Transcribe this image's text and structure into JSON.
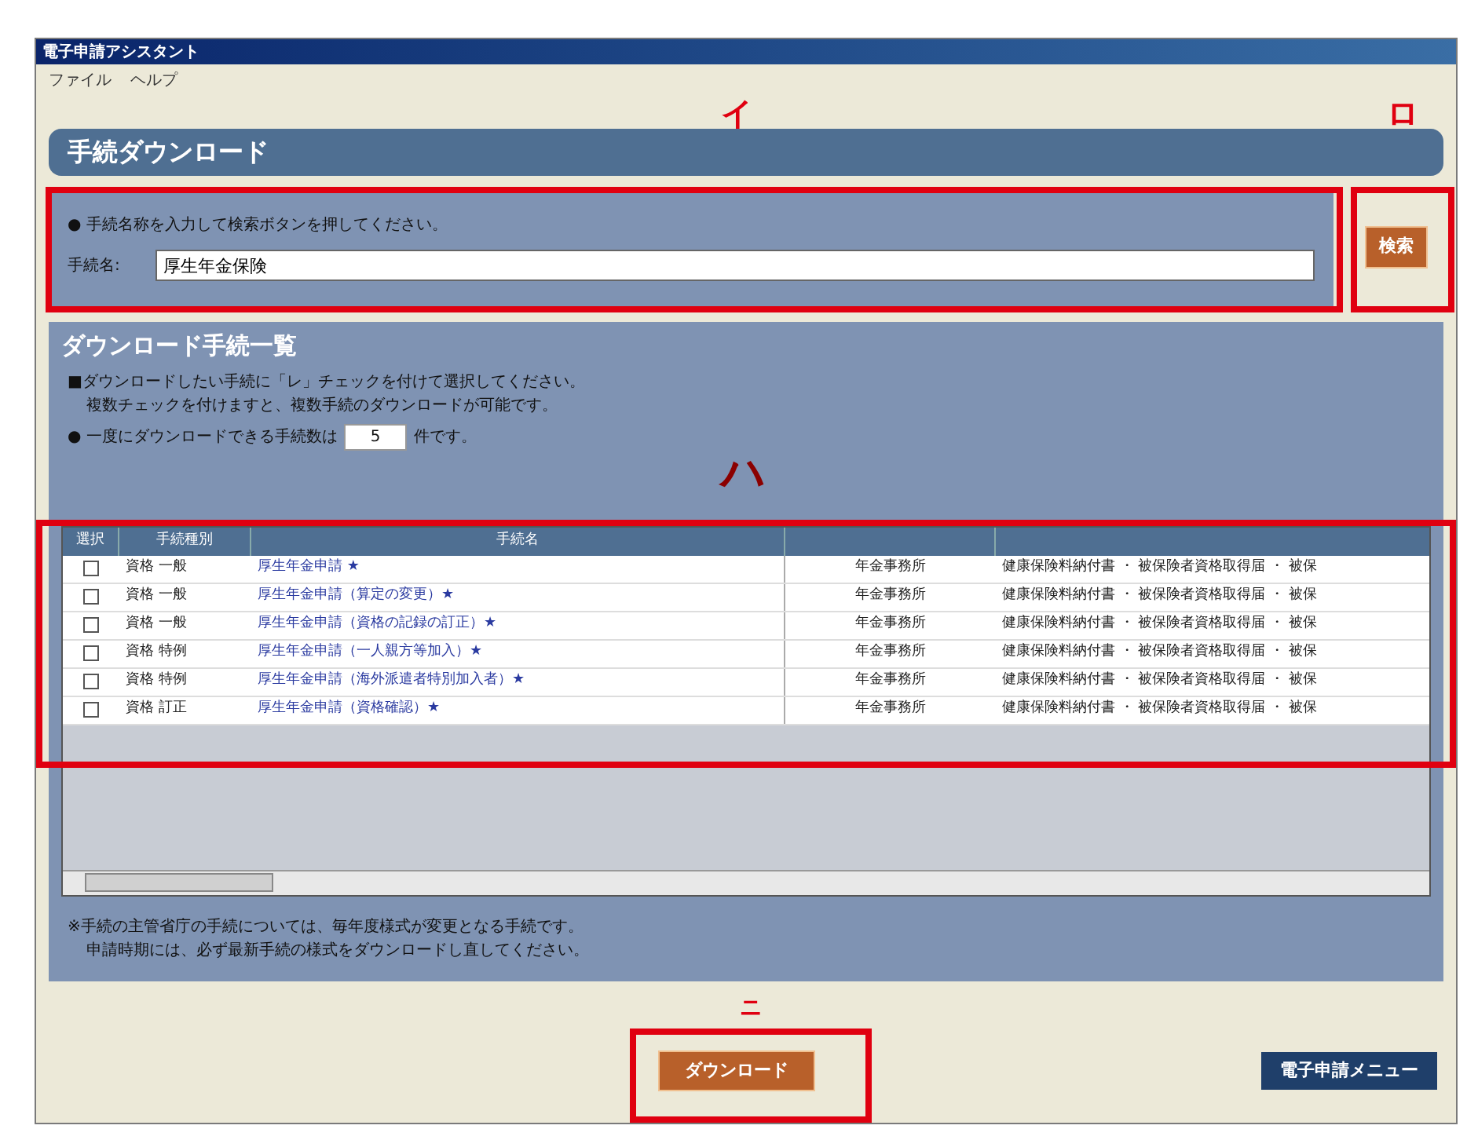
{
  "window": {
    "title": "電子申請アシスタント"
  },
  "menu": [
    "ファイル",
    "ヘルプ"
  ],
  "header": {
    "title": "手続ダウンロード"
  },
  "search": {
    "instruction": "● 手続名称を入力して検索ボタンを押してください。",
    "label": "手続名:",
    "value": "厚生年金保険",
    "button": "検索"
  },
  "list_section": {
    "title": "ダウンロード手続一覧",
    "notes": [
      "■ダウンロードしたい手続に「レ」チェックを付けて選択してください。",
      "複数チェックを付けますと、複数手続のダウンロードが可能です。"
    ],
    "limit_before": "● 一度にダウンロードできる手続数は",
    "limit_value": "5",
    "limit_after": "件です。"
  },
  "table": {
    "columns": [
      "選択",
      "手続種別",
      "手続名",
      ""
    ],
    "rows": [
      {
        "checked": false,
        "type": "資格 一般",
        "name": "厚生年金申請 ★",
        "office": "年金事務所",
        "detail": "健康保険料納付書 ・ 被保険者資格取得届 ・ 被保"
      },
      {
        "checked": false,
        "type": "資格 一般",
        "name": "厚生年金申請（算定の変更）★",
        "office": "年金事務所",
        "detail": "健康保険料納付書 ・ 被保険者資格取得届 ・ 被保"
      },
      {
        "checked": false,
        "type": "資格 一般",
        "name": "厚生年金申請（資格の記録の訂正）★",
        "office": "年金事務所",
        "detail": "健康保険料納付書 ・ 被保険者資格取得届 ・ 被保"
      },
      {
        "checked": false,
        "type": "資格 特例",
        "name": "厚生年金申請（一人親方等加入）★",
        "office": "年金事務所",
        "detail": "健康保険料納付書 ・ 被保険者資格取得届 ・ 被保"
      },
      {
        "checked": false,
        "type": "資格 特例",
        "name": "厚生年金申請（海外派遣者特別加入者）★",
        "office": "年金事務所",
        "detail": "健康保険料納付書 ・ 被保険者資格取得届 ・ 被保"
      },
      {
        "checked": false,
        "type": "資格 訂正",
        "name": "厚生年金申請（資格確認）★",
        "office": "年金事務所",
        "detail": "健康保険料納付書 ・ 被保険者資格取得届 ・ 被保"
      }
    ]
  },
  "footer_note": [
    "※手続の主管省庁の手続については、毎年度様式が変更となる手続です。",
    "申請時期には、必ず最新手続の様式をダウンロードし直してください。"
  ],
  "buttons": {
    "download": "ダウンロード",
    "menu": "電子申請メニュー"
  },
  "annotations": [
    "イ",
    "ロ",
    "ハ",
    "ニ"
  ]
}
